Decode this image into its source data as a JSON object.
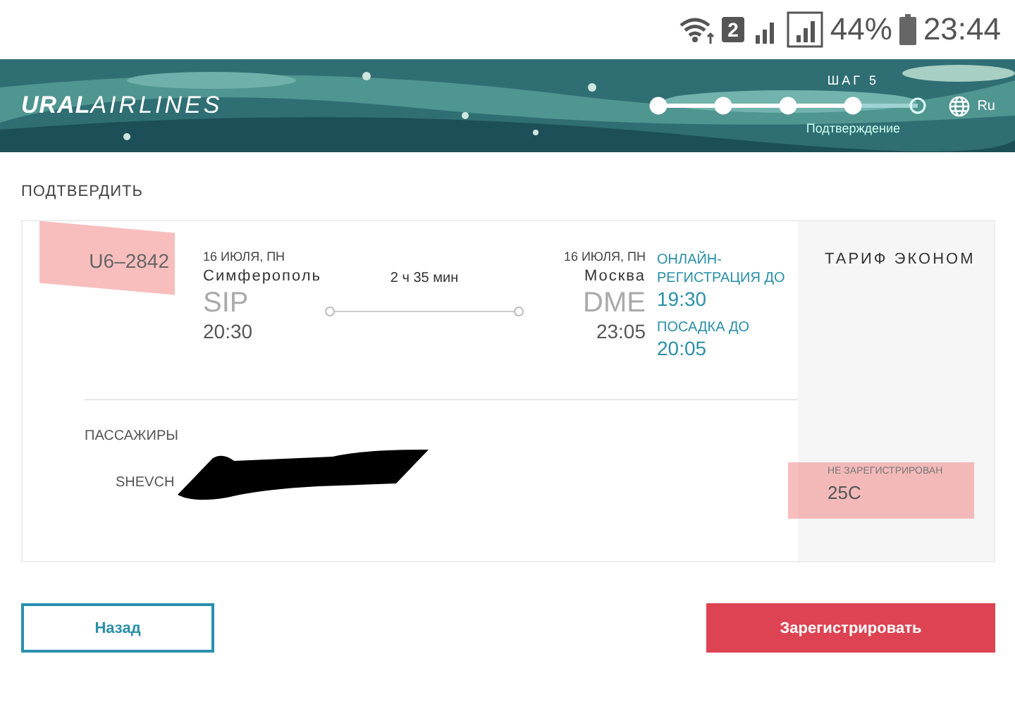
{
  "status_bar": {
    "sim_badge": "2",
    "battery": "44%",
    "time": "23:44"
  },
  "header": {
    "logo_bold": "URAL",
    "logo_light": "AIRLINES",
    "step_label": "ШАГ 5",
    "step_caption": "Подтверждение",
    "language": "Ru",
    "steps": [
      {
        "done": true
      },
      {
        "done": true
      },
      {
        "done": true
      },
      {
        "done": true
      },
      {
        "done": false
      }
    ]
  },
  "page_title": "ПОДТВЕРДИТЬ",
  "flight": {
    "number": "U6–2842",
    "departure": {
      "date": "16 ИЮЛЯ, ПН",
      "city": "Симферополь",
      "code": "SIP",
      "time": "20:30"
    },
    "duration": "2 ч 35 мин",
    "arrival": {
      "date": "16 ИЮЛЯ, ПН",
      "city": "Москва",
      "code": "DME",
      "time": "23:05"
    },
    "deadlines": [
      {
        "label": "ОНЛАЙН-РЕГИСТРАЦИЯ ДО",
        "time": "19:30"
      },
      {
        "label": "ПОСАДКА ДО",
        "time": "20:05"
      }
    ],
    "fare": "ТАРИФ ЭКОНОМ"
  },
  "passengers": {
    "heading": "ПАССАЖИРЫ",
    "items": [
      {
        "name": "SHEVCH",
        "status": "НЕ ЗАРЕГИСТРИРОВАН",
        "seat": "25C"
      }
    ]
  },
  "buttons": {
    "back": "Назад",
    "register": "Зарегистрировать"
  }
}
